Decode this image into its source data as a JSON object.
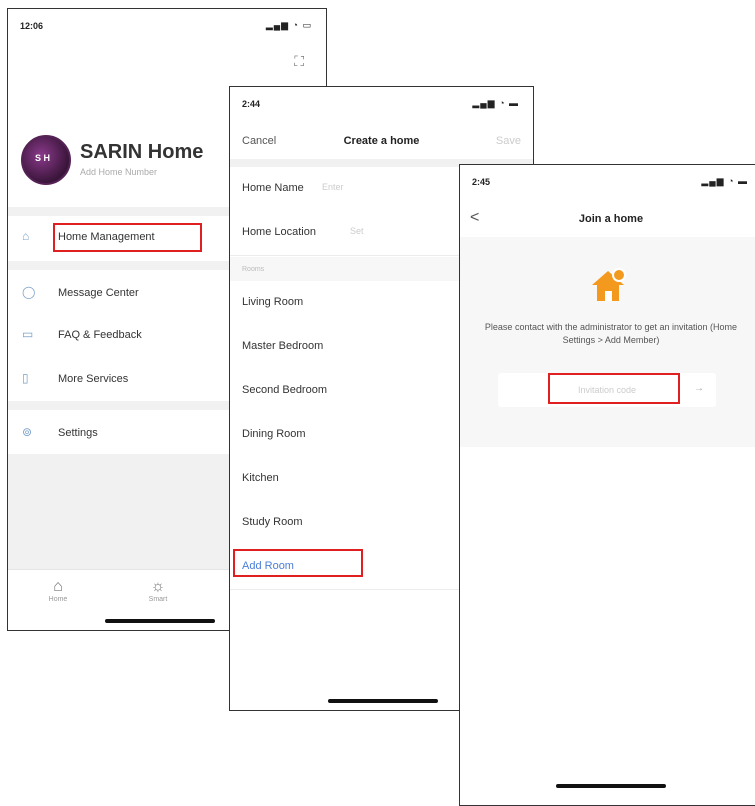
{
  "phone1": {
    "status_time": "12:06",
    "status_icons": "signal wifi battery",
    "home_name": "SARIN Home",
    "home_subtitle": "Add Home Number",
    "avatar_text": "S H",
    "menu": [
      {
        "label": "Home Management",
        "icon": "house-icon"
      },
      {
        "label": "Message Center",
        "icon": "message-icon"
      },
      {
        "label": "FAQ & Feedback",
        "icon": "faq-icon"
      },
      {
        "label": "More Services",
        "icon": "services-icon"
      },
      {
        "label": "Settings",
        "icon": "settings-icon"
      }
    ],
    "tabs": [
      {
        "label": "Home",
        "icon": "home-tab-icon"
      },
      {
        "label": "Smart",
        "icon": "smart-tab-icon"
      }
    ]
  },
  "phone2": {
    "status_time": "2:44",
    "nav": {
      "cancel": "Cancel",
      "title": "Create a home",
      "save": "Save"
    },
    "home_name_label": "Home Name",
    "home_name_placeholder": "Enter",
    "home_location_label": "Home Location",
    "home_location_value": "Set",
    "rooms_section": "Rooms",
    "rooms": [
      "Living Room",
      "Master Bedroom",
      "Second Bedroom",
      "Dining Room",
      "Kitchen",
      "Study Room"
    ],
    "add_room": "Add Room"
  },
  "phone3": {
    "status_time": "2:45",
    "nav": {
      "back": "<",
      "title": "Join a home"
    },
    "info": "Please contact with the administrator to get an invitation (Home Settings > Add Member)",
    "code_placeholder": "Invitation code",
    "code_arrow": "→"
  },
  "colors": {
    "highlight": "#e02020",
    "accent": "#4a7ed8",
    "house": "#f39a1e"
  }
}
